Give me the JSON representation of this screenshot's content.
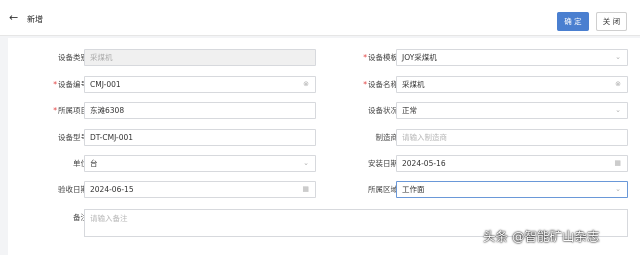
{
  "header": {
    "back_icon": "arrow-left-icon",
    "title": "新增",
    "confirm_label": "确 定",
    "close_label": "关 闭",
    "primary_color": "#4a7fd0"
  },
  "form": {
    "device_category": {
      "label": "设备类别",
      "value": "采煤机"
    },
    "device_template": {
      "label": "设备模板",
      "value": "JOY采煤机"
    },
    "device_code": {
      "label": "设备编号",
      "value": "CMJ-001"
    },
    "device_name": {
      "label": "设备名称",
      "value": "采煤机"
    },
    "project": {
      "label": "所属项目",
      "value": "东滩6308"
    },
    "device_status": {
      "label": "设备状况",
      "value": "正常"
    },
    "device_model": {
      "label": "设备型号",
      "value": "DT-CMJ-001"
    },
    "manufacturer": {
      "label": "制造商",
      "placeholder": "请输入制造商"
    },
    "unit": {
      "label": "单位",
      "value": "台"
    },
    "install_date": {
      "label": "安装日期",
      "value": "2024-05-16"
    },
    "accept_date": {
      "label": "验收日期",
      "value": "2024-06-15"
    },
    "area": {
      "label": "所属区域",
      "value": "工作面"
    },
    "remark": {
      "label": "备注",
      "placeholder": "请输入备注"
    }
  },
  "watermark": "头条 @智能矿山杂志"
}
